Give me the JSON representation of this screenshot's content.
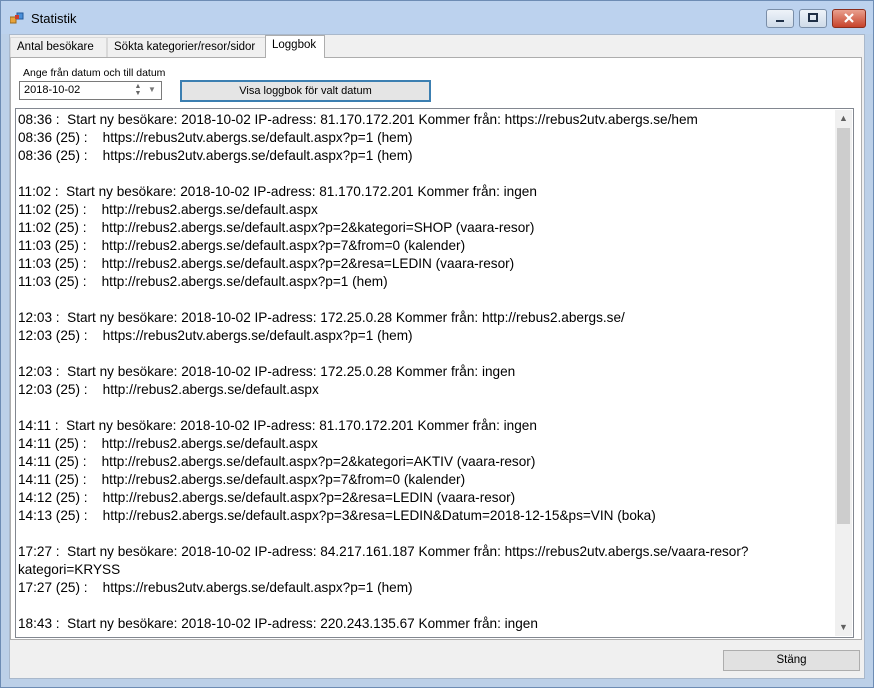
{
  "window": {
    "title": "Statistik"
  },
  "tabs": [
    {
      "label": "Antal besökare"
    },
    {
      "label": "Sökta kategorier/resor/sidor"
    },
    {
      "label": "Loggbok"
    }
  ],
  "date_filter": {
    "label": "Ange från datum och till datum",
    "value": "2018-10-02",
    "button_label": "Visa loggbok för valt datum"
  },
  "log": {
    "lines": [
      "08:36 :  Start ny besökare: 2018-10-02 IP-adress: 81.170.172.201 Kommer från: https://rebus2utv.abergs.se/hem",
      "08:36 (25) :    https://rebus2utv.abergs.se/default.aspx?p=1 (hem)",
      "08:36 (25) :    https://rebus2utv.abergs.se/default.aspx?p=1 (hem)",
      "",
      "11:02 :  Start ny besökare: 2018-10-02 IP-adress: 81.170.172.201 Kommer från: ingen",
      "11:02 (25) :    http://rebus2.abergs.se/default.aspx",
      "11:02 (25) :    http://rebus2.abergs.se/default.aspx?p=2&kategori=SHOP (vaara-resor)",
      "11:03 (25) :    http://rebus2.abergs.se/default.aspx?p=7&from=0 (kalender)",
      "11:03 (25) :    http://rebus2.abergs.se/default.aspx?p=2&resa=LEDIN (vaara-resor)",
      "11:03 (25) :    http://rebus2.abergs.se/default.aspx?p=1 (hem)",
      "",
      "12:03 :  Start ny besökare: 2018-10-02 IP-adress: 172.25.0.28 Kommer från: http://rebus2.abergs.se/",
      "12:03 (25) :    https://rebus2utv.abergs.se/default.aspx?p=1 (hem)",
      "",
      "12:03 :  Start ny besökare: 2018-10-02 IP-adress: 172.25.0.28 Kommer från: ingen",
      "12:03 (25) :    http://rebus2.abergs.se/default.aspx",
      "",
      "14:11 :  Start ny besökare: 2018-10-02 IP-adress: 81.170.172.201 Kommer från: ingen",
      "14:11 (25) :    http://rebus2.abergs.se/default.aspx",
      "14:11 (25) :    http://rebus2.abergs.se/default.aspx?p=2&kategori=AKTIV (vaara-resor)",
      "14:11 (25) :    http://rebus2.abergs.se/default.aspx?p=7&from=0 (kalender)",
      "14:12 (25) :    http://rebus2.abergs.se/default.aspx?p=2&resa=LEDIN (vaara-resor)",
      "14:13 (25) :    http://rebus2.abergs.se/default.aspx?p=3&resa=LEDIN&Datum=2018-12-15&ps=VIN (boka)",
      "",
      "17:27 :  Start ny besökare: 2018-10-02 IP-adress: 84.217.161.187 Kommer från: https://rebus2utv.abergs.se/vaara-resor?",
      "kategori=KRYSS",
      "17:27 (25) :    https://rebus2utv.abergs.se/default.aspx?p=1 (hem)",
      "",
      "18:43 :  Start ny besökare: 2018-10-02 IP-adress: 220.243.135.67 Kommer från: ingen"
    ]
  },
  "footer": {
    "close_label": "Stäng"
  }
}
